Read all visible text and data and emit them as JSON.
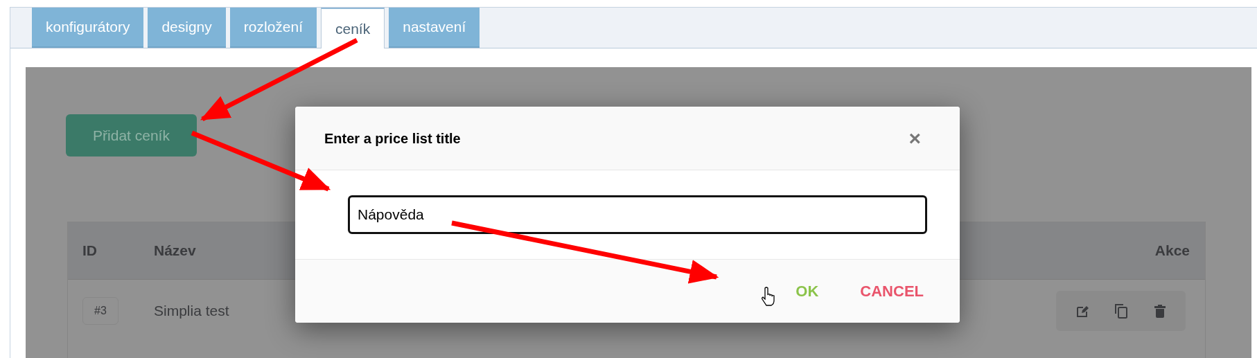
{
  "tabs": [
    {
      "label": "konfigurátory",
      "selected": false
    },
    {
      "label": "designy",
      "selected": false
    },
    {
      "label": "rozložení",
      "selected": false
    },
    {
      "label": "ceník",
      "selected": true
    },
    {
      "label": "nastavení",
      "selected": false
    }
  ],
  "add_button": "Přidat ceník",
  "table": {
    "columns": [
      "ID",
      "Název",
      "Akce"
    ],
    "rows": [
      {
        "id": "#3",
        "name": "Simplia test"
      }
    ]
  },
  "modal": {
    "title": "Enter a price list title",
    "close": "×",
    "input_value": "Nápověda",
    "ok": "OK",
    "cancel": "CANCEL"
  }
}
